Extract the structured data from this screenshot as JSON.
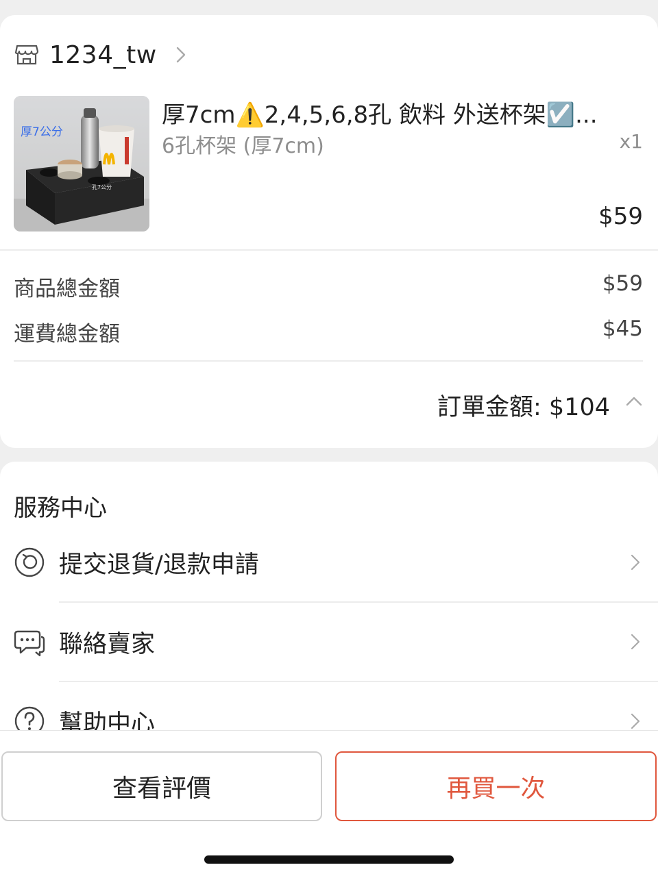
{
  "shop": {
    "name": "1234_tw"
  },
  "product": {
    "title": "厚7cm⚠️2,4,5,6,8孔 飲料 外送杯架☑️...",
    "variant": "6孔杯架 (厚7cm)",
    "quantity": "x1",
    "price": "$59",
    "thumbnail_caption": "厚7公分",
    "thumbnail_tag": "孔7公分"
  },
  "summary": {
    "subtotal_label": "商品總金額",
    "subtotal_value": "$59",
    "shipping_label": "運費總金額",
    "shipping_value": "$45",
    "order_total": "訂單金額: $104"
  },
  "service": {
    "title": "服務中心",
    "items": [
      {
        "label": "提交退貨/退款申請",
        "icon": "return-refund-icon"
      },
      {
        "label": "聯絡賣家",
        "icon": "chat-icon"
      },
      {
        "label": "幫助中心",
        "icon": "help-icon"
      }
    ]
  },
  "actions": {
    "review_label": "查看評價",
    "rebuy_label": "再買一次"
  },
  "colors": {
    "accent": "#e0573d",
    "background": "#efefef",
    "card": "#ffffff",
    "secondary_text": "#8e8e8e"
  }
}
